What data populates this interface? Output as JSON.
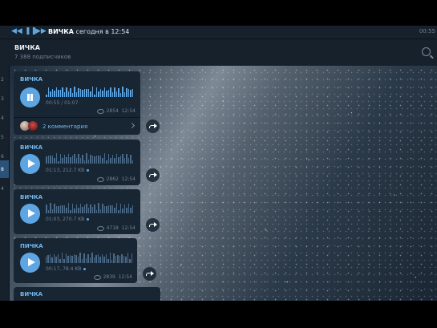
{
  "topbar": {
    "title_name": "ВИЧКА",
    "title_rest": " сегодня в 12:54",
    "time": "00:55"
  },
  "header": {
    "channel_name": "ВИЧКА",
    "subscribers": "7 388 подписчиков"
  },
  "sidebar_numbers": [
    "2",
    "3",
    "4",
    "5",
    "6",
    "8",
    "4"
  ],
  "messages": [
    {
      "title": "ВИЧКА",
      "state": "playing",
      "duration": "00:55 / 01:07",
      "show_dot": false,
      "views": "2854",
      "time": "12:54",
      "comments": "2 комментария"
    },
    {
      "title": "ВИЧКА",
      "state": "paused",
      "duration": "01:13, 212.7 KB",
      "show_dot": true,
      "views": "2862",
      "time": "12:54"
    },
    {
      "title": "ВИЧКА",
      "state": "paused",
      "duration": "01:03, 270.7 KB",
      "show_dot": true,
      "views": "4718",
      "time": "12:54"
    },
    {
      "title": "ПИЧКА",
      "state": "paused",
      "duration": "00:17, 78.4 KB",
      "show_dot": true,
      "views": "2839",
      "time": "12:54"
    },
    {
      "title": "ВИЧКА"
    }
  ],
  "colors": {
    "accent": "#5ea6e3",
    "bubble": "#182533",
    "wave_played": "#5ea6e3",
    "wave_unplayed": "#4a6a88"
  }
}
